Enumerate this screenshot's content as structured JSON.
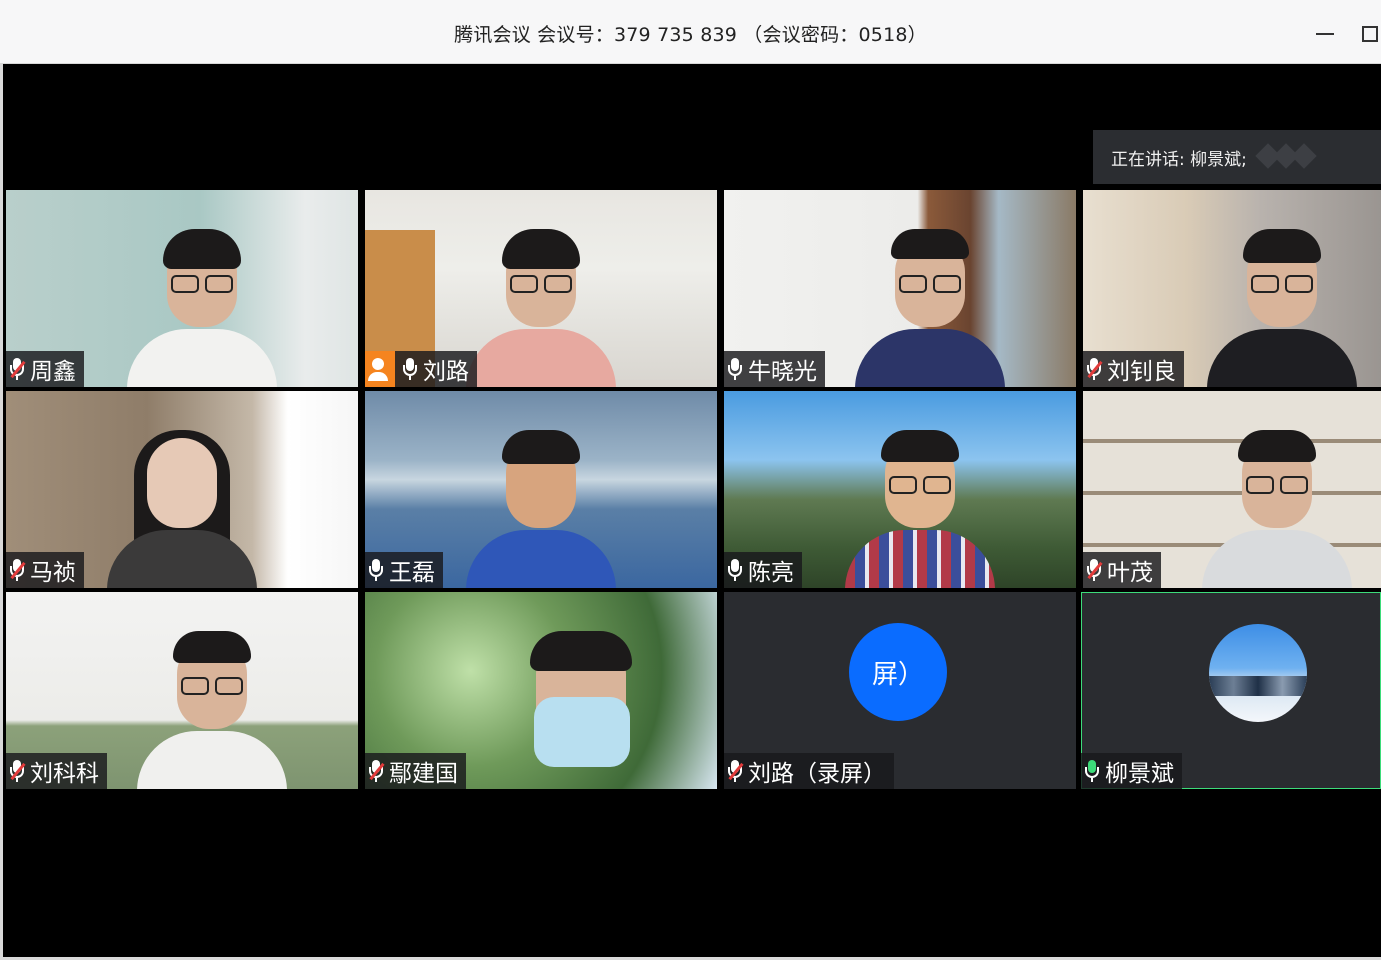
{
  "window": {
    "title": "腾讯会议 会议号：379 735 839 （会议密码：0518）"
  },
  "speaking": {
    "label": "正在讲话: 柳景斌;"
  },
  "participants": [
    {
      "name": "周鑫",
      "mic": "muted"
    },
    {
      "name": "刘路",
      "mic": "on",
      "host": true
    },
    {
      "name": "牛晓光",
      "mic": "on"
    },
    {
      "name": "刘钊良",
      "mic": "muted"
    },
    {
      "name": "马祯",
      "mic": "muted"
    },
    {
      "name": "王磊",
      "mic": "on"
    },
    {
      "name": "陈亮",
      "mic": "on"
    },
    {
      "name": "叶茂",
      "mic": "muted"
    },
    {
      "name": "刘科科",
      "mic": "muted"
    },
    {
      "name": "鄢建国",
      "mic": "muted"
    },
    {
      "name": "刘路（录屏）",
      "mic": "muted",
      "avatar_text": "屏）"
    },
    {
      "name": "柳景斌",
      "mic": "speaking",
      "active": true
    }
  ],
  "colors": {
    "accent_blue": "#0a6cff",
    "host_orange": "#f5841f",
    "speaking_green": "#3ddc7a",
    "muted_red": "#e23b3b"
  }
}
